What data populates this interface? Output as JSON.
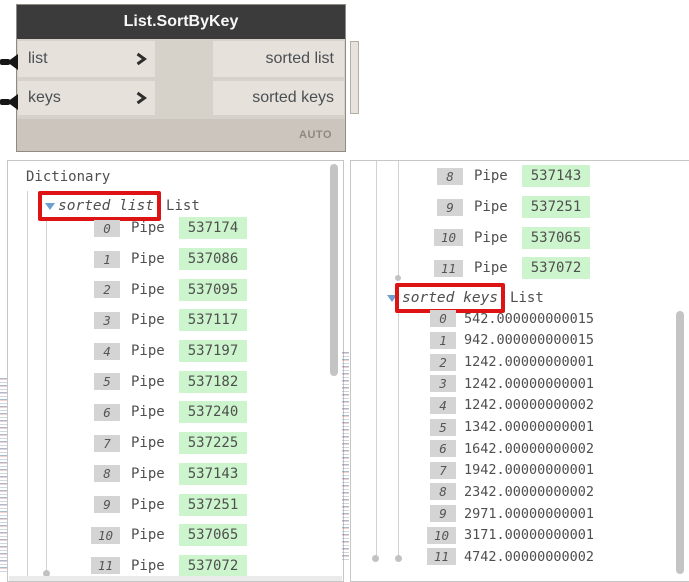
{
  "node": {
    "title": "List.SortByKey",
    "inputs": [
      {
        "label": "list"
      },
      {
        "label": "keys"
      }
    ],
    "outputs": [
      {
        "label": "sorted list"
      },
      {
        "label": "sorted keys"
      }
    ],
    "lacing_label": "AUTO"
  },
  "left_panel": {
    "root_label": "Dictionary",
    "branch_label": "sorted list",
    "branch_type": "List",
    "items": [
      {
        "index": "0",
        "type": "Pipe",
        "value": "537174"
      },
      {
        "index": "1",
        "type": "Pipe",
        "value": "537086"
      },
      {
        "index": "2",
        "type": "Pipe",
        "value": "537095"
      },
      {
        "index": "3",
        "type": "Pipe",
        "value": "537117"
      },
      {
        "index": "4",
        "type": "Pipe",
        "value": "537197"
      },
      {
        "index": "5",
        "type": "Pipe",
        "value": "537182"
      },
      {
        "index": "6",
        "type": "Pipe",
        "value": "537240"
      },
      {
        "index": "7",
        "type": "Pipe",
        "value": "537225"
      },
      {
        "index": "8",
        "type": "Pipe",
        "value": "537143"
      },
      {
        "index": "9",
        "type": "Pipe",
        "value": "537251"
      },
      {
        "index": "10",
        "type": "Pipe",
        "value": "537065"
      },
      {
        "index": "11",
        "type": "Pipe",
        "value": "537072"
      }
    ]
  },
  "right_panel": {
    "tail_items": [
      {
        "index": "8",
        "type": "Pipe",
        "value": "537143"
      },
      {
        "index": "9",
        "type": "Pipe",
        "value": "537251"
      },
      {
        "index": "10",
        "type": "Pipe",
        "value": "537065"
      },
      {
        "index": "11",
        "type": "Pipe",
        "value": "537072"
      }
    ],
    "branch_label": "sorted keys",
    "branch_type": "List",
    "key_items": [
      {
        "index": "0",
        "value": "542.000000000015"
      },
      {
        "index": "1",
        "value": "942.000000000015"
      },
      {
        "index": "2",
        "value": "1242.00000000001"
      },
      {
        "index": "3",
        "value": "1242.00000000001"
      },
      {
        "index": "4",
        "value": "1242.00000000002"
      },
      {
        "index": "5",
        "value": "1342.00000000001"
      },
      {
        "index": "6",
        "value": "1642.00000000002"
      },
      {
        "index": "7",
        "value": "1942.00000000001"
      },
      {
        "index": "8",
        "value": "2342.00000000002"
      },
      {
        "index": "9",
        "value": "2971.00000000001"
      },
      {
        "index": "10",
        "value": "3171.00000000001"
      },
      {
        "index": "11",
        "value": "4742.00000000002"
      }
    ]
  },
  "colors": {
    "annotation_red": "#de1414",
    "value_badge_green": "#cdf5cd",
    "index_badge_gray": "#d4d4d4",
    "node_header": "#3b3b3b",
    "port_row": "#e6e2db",
    "node_body": "#d6d1c9",
    "footer_bar": "#cbc5bd",
    "expander_blue": "#6b9fd4"
  }
}
